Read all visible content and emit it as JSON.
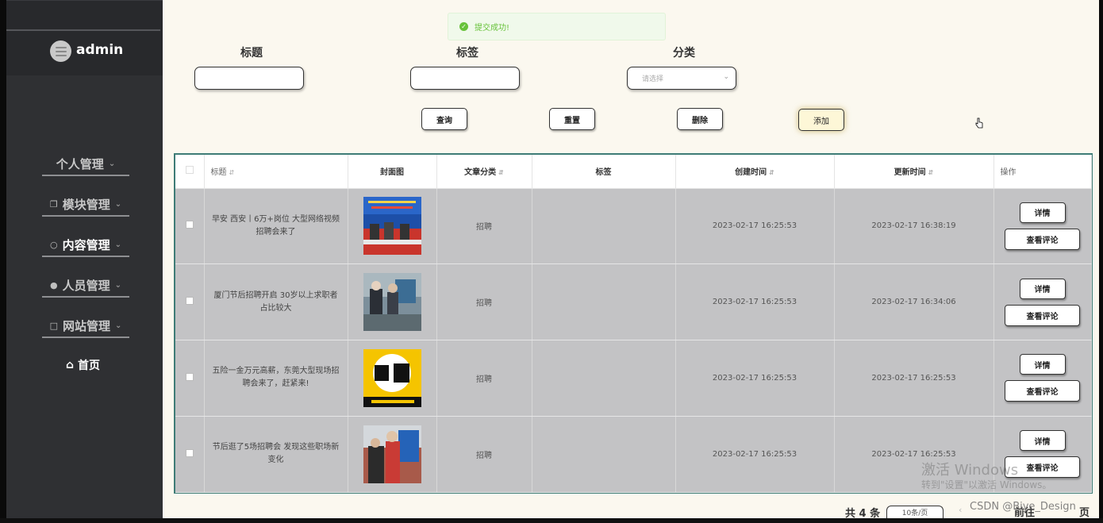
{
  "sidebar": {
    "username": "admin",
    "menu": [
      {
        "label": "个人管理",
        "icon": "",
        "active": false
      },
      {
        "label": "模块管理",
        "icon": "module-icon",
        "active": false
      },
      {
        "label": "内容管理",
        "icon": "chat-icon",
        "active": true
      },
      {
        "label": "人员管理",
        "icon": "user-icon",
        "active": false
      },
      {
        "label": "网站管理",
        "icon": "monitor-icon",
        "active": false
      }
    ],
    "home": "首页"
  },
  "toast": {
    "message": "提交成功!"
  },
  "filters": {
    "title_label": "标题",
    "tag_label": "标签",
    "category_label": "分类",
    "category_placeholder": "请选择"
  },
  "buttons": {
    "search": "查询",
    "reset": "重置",
    "delete": "删除",
    "add": "添加"
  },
  "table": {
    "headers": {
      "title": "标题",
      "cover": "封面图",
      "category": "文章分类",
      "tags": "标签",
      "created": "创建时间",
      "updated": "更新时间",
      "actions": "操作"
    },
    "rows": [
      {
        "title": "早安 西安丨6万+岗位 大型网络视频招聘会来了",
        "category": "招聘",
        "tags": "",
        "created": "2023-02-17 16:25:53",
        "updated": "2023-02-17 16:38:19"
      },
      {
        "title": "厦门节后招聘开启 30岁以上求职者占比较大",
        "category": "招聘",
        "tags": "",
        "created": "2023-02-17 16:25:53",
        "updated": "2023-02-17 16:34:06"
      },
      {
        "title": "五险一金万元高薪，东莞大型现场招聘会来了，赶紧来!",
        "category": "招聘",
        "tags": "",
        "created": "2023-02-17 16:25:53",
        "updated": "2023-02-17 16:25:53"
      },
      {
        "title": "节后逛了5场招聘会 发现这些职场新变化",
        "category": "招聘",
        "tags": "",
        "created": "2023-02-17 16:25:53",
        "updated": "2023-02-17 16:25:53"
      }
    ],
    "detail_label": "详情",
    "comment_label": "查看评论"
  },
  "pagination": {
    "total": "共 4 条",
    "page_size": "10条/页",
    "goto": "前往",
    "page": "页"
  },
  "overlay": {
    "activate_windows": "激活 Windows",
    "activate_hint": "转到\"设置\"以激活 Windows。",
    "csdn": "CSDN @Biye_Design"
  },
  "colors": {
    "sidebar_bg": "#2f3033",
    "main_bg": "#fbf8ef",
    "table_border": "#3e7c76",
    "row_bg": "#c3c3c5",
    "toast_green": "#67c23a"
  }
}
